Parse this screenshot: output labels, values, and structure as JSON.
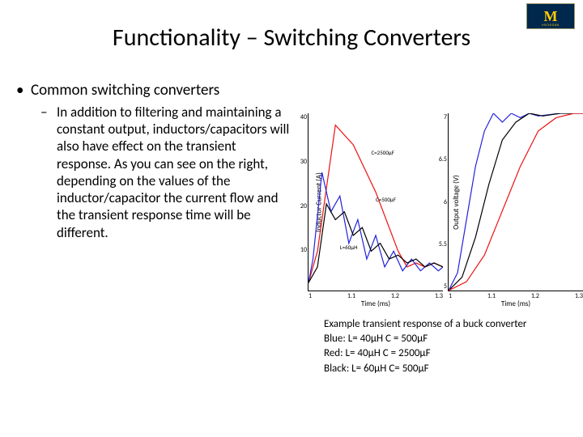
{
  "logo": {
    "letter": "M",
    "text": "MICHIGAN"
  },
  "title": "Functionality – Switching Converters",
  "bullets": {
    "b1": "Common switching converters",
    "b2": "In addition to filtering and maintaining a constant output, inductors/capacitors will also have effect on the transient response. As you can see on the right, depending on the values of the inductor/capacitor the current flow and the transient response time will be different."
  },
  "caption": {
    "line1": "Example transient response of a buck converter",
    "line2": "Blue: L= 40μH C = 500μF",
    "line3": "Red:  L= 40μH C = 2500μF",
    "line4": "Black: L= 60μH C= 500μF"
  },
  "chart_data": [
    {
      "type": "line",
      "title": "",
      "xlabel": "Time (ms)",
      "ylabel": "Inductor Current (A)",
      "xlim": [
        1.0,
        1.3
      ],
      "ylim": [
        0,
        45
      ],
      "xticks": [
        "1",
        "1.1",
        "1.2",
        "1.3"
      ],
      "yticks": [
        "40",
        "30",
        "20",
        "10",
        ""
      ],
      "annotations": [
        {
          "text": "C=2500μF",
          "x": 1.14,
          "y": 36
        },
        {
          "text": "C=500μF",
          "x": 1.15,
          "y": 24
        },
        {
          "text": "L=60μH",
          "x": 1.07,
          "y": 12
        }
      ],
      "series": [
        {
          "name": "red",
          "color": "#e11",
          "x": [
            1.0,
            1.02,
            1.06,
            1.1,
            1.15,
            1.2,
            1.22,
            1.24,
            1.26,
            1.28,
            1.3
          ],
          "y": [
            2,
            10,
            42,
            37,
            25,
            10,
            6,
            7,
            6,
            7,
            6
          ]
        },
        {
          "name": "blue",
          "color": "#22d",
          "x": [
            1.0,
            1.01,
            1.03,
            1.05,
            1.07,
            1.09,
            1.11,
            1.13,
            1.15,
            1.17,
            1.19,
            1.21,
            1.23,
            1.25,
            1.27,
            1.29,
            1.3
          ],
          "y": [
            2,
            8,
            30,
            20,
            24,
            12,
            18,
            8,
            14,
            6,
            10,
            5,
            8,
            5,
            7,
            5,
            6
          ]
        },
        {
          "name": "black",
          "color": "#000",
          "x": [
            1.0,
            1.02,
            1.04,
            1.06,
            1.08,
            1.1,
            1.12,
            1.14,
            1.16,
            1.18,
            1.2,
            1.22,
            1.24,
            1.26,
            1.28,
            1.3
          ],
          "y": [
            2,
            6,
            22,
            18,
            20,
            14,
            16,
            10,
            12,
            8,
            9,
            7,
            8,
            6,
            7,
            6
          ]
        }
      ]
    },
    {
      "type": "line",
      "title": "",
      "xlabel": "Time (ms)",
      "ylabel": "Output voltage (V)",
      "xlim": [
        1.0,
        1.3
      ],
      "ylim": [
        5.0,
        7.0
      ],
      "xticks": [
        "1",
        "1.1",
        "1.2",
        "1.3"
      ],
      "yticks": [
        "7",
        "6.5",
        "6",
        "5.5",
        "5"
      ],
      "annotations": [],
      "series": [
        {
          "name": "blue",
          "color": "#22d",
          "x": [
            1.0,
            1.02,
            1.04,
            1.06,
            1.08,
            1.1,
            1.12,
            1.14,
            1.16,
            1.18,
            1.2,
            1.25,
            1.3
          ],
          "y": [
            5.0,
            5.2,
            5.8,
            6.4,
            6.8,
            7.0,
            6.9,
            7.0,
            6.95,
            7.0,
            6.97,
            7.0,
            7.0
          ]
        },
        {
          "name": "black",
          "color": "#000",
          "x": [
            1.0,
            1.03,
            1.06,
            1.09,
            1.12,
            1.15,
            1.18,
            1.21,
            1.25,
            1.3
          ],
          "y": [
            5.0,
            5.15,
            5.6,
            6.2,
            6.7,
            6.9,
            7.0,
            6.97,
            7.0,
            7.0
          ]
        },
        {
          "name": "red",
          "color": "#e11",
          "x": [
            1.0,
            1.04,
            1.08,
            1.12,
            1.16,
            1.2,
            1.24,
            1.28,
            1.3
          ],
          "y": [
            5.0,
            5.1,
            5.4,
            5.9,
            6.4,
            6.8,
            6.95,
            7.0,
            7.0
          ]
        }
      ]
    }
  ]
}
